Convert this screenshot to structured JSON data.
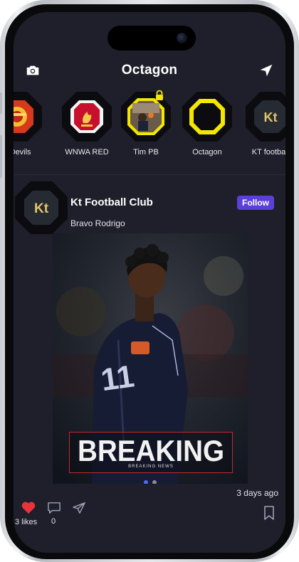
{
  "header": {
    "title": "Octagon",
    "camera_icon": "camera-icon",
    "send_icon": "send-arrow-icon"
  },
  "stories": [
    {
      "label": "d Devils",
      "icon": "devils-badge"
    },
    {
      "label": "WNWA RED",
      "icon": "liverpool-crest"
    },
    {
      "label": "Tim PB",
      "icon": "player-photo",
      "locked": true
    },
    {
      "label": "Octagon",
      "icon": "octagon-ring"
    },
    {
      "label": "KT football",
      "icon": "kt-logo"
    }
  ],
  "post": {
    "author": "Kt Football Club",
    "follow_label": "Follow",
    "caption": "Bravo Rodrigo",
    "banner_title": "BREAKING",
    "banner_subtitle": "BREAKING NEWS",
    "time": "3 days ago",
    "likes": "3 likes",
    "comments": "0",
    "carousel": {
      "count": 2,
      "active": 1
    }
  },
  "colors": {
    "background": "#1f1f2b",
    "accent": "#5b3fd8",
    "story_ring": "#f5e600",
    "like": "#e8333b"
  }
}
